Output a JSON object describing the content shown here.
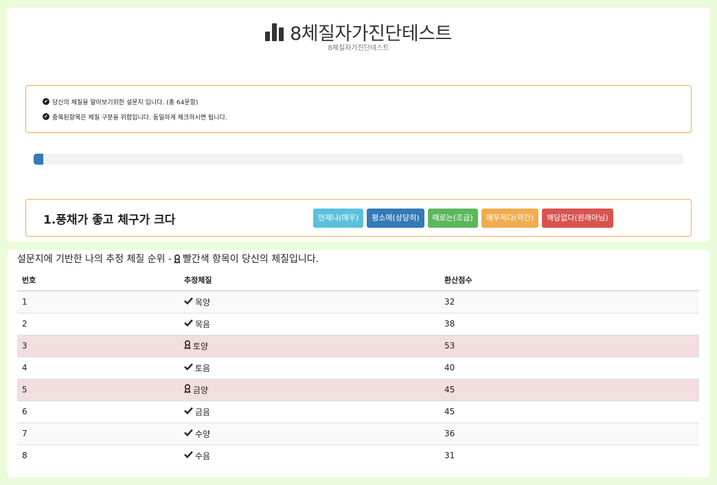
{
  "header": {
    "title": "8체질자가진단테스트",
    "subtitle": "8체질자가진단테스트",
    "title_icon": "bar-chart-icon"
  },
  "notice": {
    "lines": [
      "당신의 체질을 알아보기위한 설문지 입니다. (총 64문항)",
      "중복된항목은 체질 구분을 위함입니다. 동일하게 체크하시면 됩니다."
    ],
    "icon": "check-circle-icon",
    "border_color": "#f0ad4e"
  },
  "progress": {
    "value_fraction": 0.015,
    "color": "#337ab7"
  },
  "question": {
    "text": "1.풍채가 좋고 체구가 크다",
    "answers": [
      {
        "label": "언제나(매우)",
        "color": "#5bc0de"
      },
      {
        "label": "평소에(상당히)",
        "color": "#337ab7"
      },
      {
        "label": "때로는(조금)",
        "color": "#5cb85c"
      },
      {
        "label": "매우적다(약간)",
        "color": "#f0ad4e"
      },
      {
        "label": "해당없다(원래아님)",
        "color": "#d9534f"
      }
    ]
  },
  "results": {
    "heading_prefix": "설문지에 기반한 나의 추정 체질 순위 -",
    "heading_suffix": "빨간색 항목이 당신의 체질입니다.",
    "heading_icon": "award-ribbon-icon",
    "columns": [
      "번호",
      "추정체질",
      "환산점수"
    ],
    "highlight_color": "#f2dede",
    "rows": [
      {
        "num": "1",
        "type": "목양",
        "score": "32",
        "icon": "check-icon"
      },
      {
        "num": "2",
        "type": "목음",
        "score": "38",
        "icon": "check-icon"
      },
      {
        "num": "3",
        "type": "토양",
        "score": "53",
        "icon": "award-ribbon-icon"
      },
      {
        "num": "4",
        "type": "토음",
        "score": "40",
        "icon": "check-icon"
      },
      {
        "num": "5",
        "type": "금양",
        "score": "45",
        "icon": "award-ribbon-icon"
      },
      {
        "num": "6",
        "type": "금음",
        "score": "45",
        "icon": "check-icon"
      },
      {
        "num": "7",
        "type": "수양",
        "score": "36",
        "icon": "check-icon"
      },
      {
        "num": "8",
        "type": "수음",
        "score": "31",
        "icon": "check-icon"
      }
    ]
  }
}
